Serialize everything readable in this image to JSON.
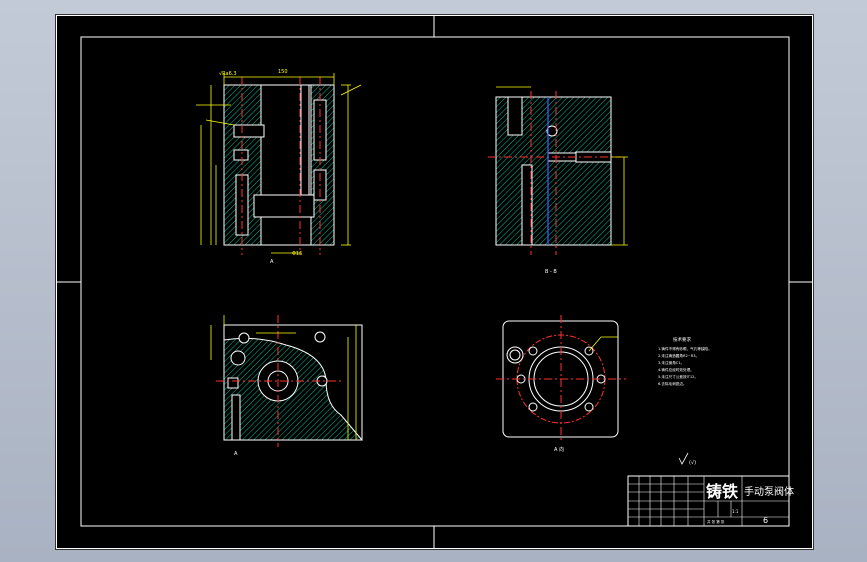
{
  "title_block": {
    "material": "铸铁",
    "part_name": "手动泵阀体",
    "sheet": "6",
    "scale": "1:1",
    "row_text": "共 张 第 张"
  },
  "views": {
    "section_a_label": "A",
    "section_b_label": "B - B",
    "top_view_label": "A",
    "bottom_label": "A 向"
  },
  "roughness_note": "(√)",
  "tech_notes": {
    "heading": "技术要求",
    "lines": [
      "1.铸件不得有砂眼、气孔等缺陷。",
      "2.未注铸造圆角R2~R3。",
      "3.未注倒角C1。",
      "4.铸件应经时效处理。",
      "5.未注尺寸公差按IT12。",
      "6.去除毛刺锐边。"
    ]
  },
  "colors": {
    "outline": "#ffffff",
    "dimension": "#ffff00",
    "hatch": "#00c0a0",
    "center": "#ff3030",
    "blue": "#4060ff"
  }
}
